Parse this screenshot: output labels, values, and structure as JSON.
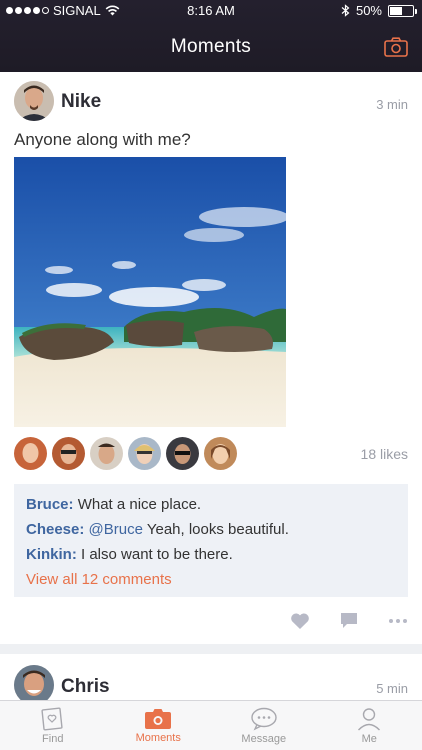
{
  "status_bar": {
    "carrier": "SIGNAL",
    "time": "8:16 AM",
    "battery": "50%"
  },
  "header": {
    "title": "Moments"
  },
  "posts": [
    {
      "author": "Nike",
      "time": "3 min",
      "caption": "Anyone along with me?",
      "likes": "18 likes",
      "comments": [
        {
          "author": "Bruce:",
          "mention": "",
          "text": "What a nice place."
        },
        {
          "author": "Cheese:",
          "mention": "@Bruce",
          "text": "Yeah, looks beautiful."
        },
        {
          "author": "Kinkin:",
          "mention": "",
          "text": "I also want to be there."
        }
      ],
      "view_all": "View all 12 comments"
    },
    {
      "author": "Chris",
      "time": "5 min"
    }
  ],
  "tabbar": {
    "tabs": [
      {
        "label": "Find",
        "icon": "find-icon"
      },
      {
        "label": "Moments",
        "icon": "camera-icon"
      },
      {
        "label": "Message",
        "icon": "message-icon"
      },
      {
        "label": "Me",
        "icon": "profile-icon"
      }
    ],
    "active": "Moments"
  },
  "colors": {
    "accent": "#e8724a",
    "link": "#3f66a0",
    "header": "#1e1b26"
  }
}
